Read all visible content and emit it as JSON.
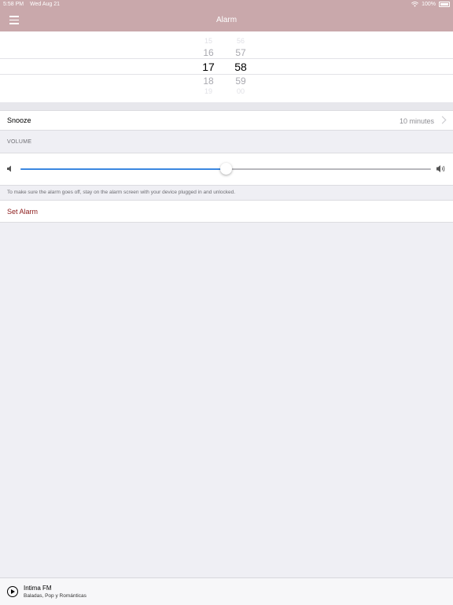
{
  "status_bar": {
    "time": "5:58 PM",
    "date": "Wed Aug 21",
    "battery": "100%"
  },
  "nav": {
    "title": "Alarm",
    "menu_icon": "hamburger-menu-icon"
  },
  "picker": {
    "hours": [
      "15",
      "16",
      "17",
      "18",
      "19"
    ],
    "minutes": [
      "56",
      "57",
      "58",
      "59",
      "00"
    ],
    "selected_hour": "17",
    "selected_minute": "58"
  },
  "snooze": {
    "label": "Snooze",
    "value": "10 minutes"
  },
  "volume": {
    "header": "VOLUME",
    "level_fraction": 0.5
  },
  "note": "To make sure the alarm goes off, stay on the alarm screen with your device plugged in and unlocked.",
  "actions": {
    "set_alarm": "Set Alarm"
  },
  "player": {
    "station": "Intima FM",
    "genre": "Baladas, Pop y Románticas"
  },
  "colors": {
    "nav": "#c9a8ab",
    "accent": "#8b1a1a",
    "slider": "#3b87e0"
  }
}
